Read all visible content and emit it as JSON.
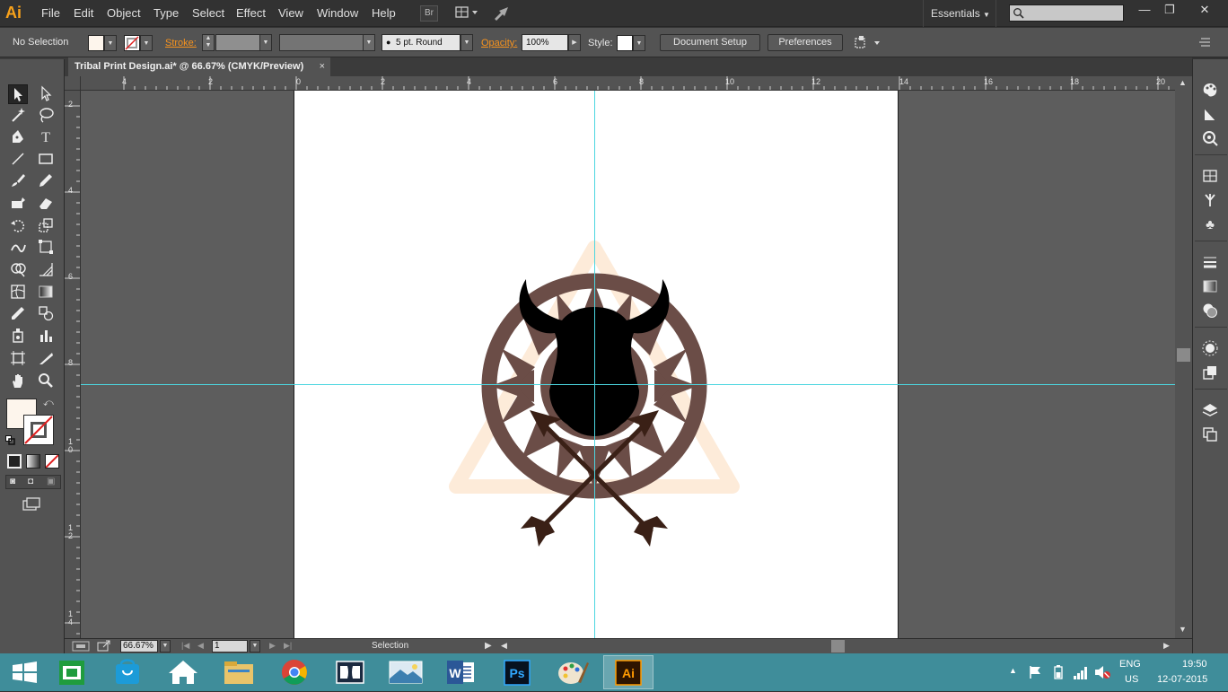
{
  "app": {
    "logo": "Ai"
  },
  "menu": [
    "File",
    "Edit",
    "Object",
    "Type",
    "Select",
    "Effect",
    "View",
    "Window",
    "Help"
  ],
  "menubar_icons": {
    "bridge": "Br"
  },
  "workspace": {
    "label": "Essentials"
  },
  "window_controls": {
    "minimize": "—",
    "restore": "❐",
    "close": "✕"
  },
  "control_bar": {
    "selection_label": "No Selection",
    "stroke_label": "Stroke:",
    "brush_value": "5 pt. Round",
    "opacity_label": "Opacity:",
    "opacity_value": "100%",
    "style_label": "Style:",
    "document_setup": "Document Setup",
    "preferences": "Preferences"
  },
  "document_tab": {
    "title": "Tribal Print Design.ai* @ 66.67% (CMYK/Preview)",
    "close": "×"
  },
  "ruler_top": [
    "4",
    "2",
    "0",
    "2",
    "4",
    "6",
    "8",
    "10",
    "12",
    "14",
    "16",
    "18",
    "20"
  ],
  "ruler_left": [
    "2",
    "4",
    "6",
    "8",
    "1\n0",
    "1\n2",
    "1\n4"
  ],
  "status_bar": {
    "zoom": "66.67%",
    "artboard": "1",
    "tool": "Selection"
  },
  "tools": [
    "selection-tool",
    "direct-selection-tool",
    "magic-wand-tool",
    "lasso-tool",
    "pen-tool",
    "type-tool",
    "line-tool",
    "rectangle-tool",
    "paintbrush-tool",
    "pencil-tool",
    "blob-brush-tool",
    "eraser-tool",
    "rotate-tool",
    "scale-tool",
    "warp-tool",
    "free-transform-tool",
    "shape-builder-tool",
    "perspective-grid-tool",
    "mesh-tool",
    "gradient-tool",
    "eyedropper-tool",
    "blend-tool",
    "symbol-sprayer-tool",
    "column-graph-tool",
    "artboard-tool",
    "slice-tool",
    "hand-tool",
    "zoom-tool"
  ],
  "colors": {
    "fill": "#fdf5ec",
    "wheel": "#6b4d47",
    "skull": "#000000",
    "arrows": "#3a2016",
    "triangle": "#fde9d9",
    "guides": "#4cd6e0",
    "taskbar": "#3f8d9a"
  },
  "taskbar": {
    "apps": [
      "windows-start",
      "file-manager",
      "store",
      "home",
      "file-explorer",
      "chrome",
      "dolby",
      "photos",
      "word",
      "photoshop",
      "paint",
      "illustrator"
    ],
    "ps_label": "Ps",
    "ai_label": "Ai",
    "word_label": "W",
    "dolby_label": "D",
    "lang": "ENG",
    "region": "US",
    "time": "19:50",
    "date": "12-07-2015"
  }
}
